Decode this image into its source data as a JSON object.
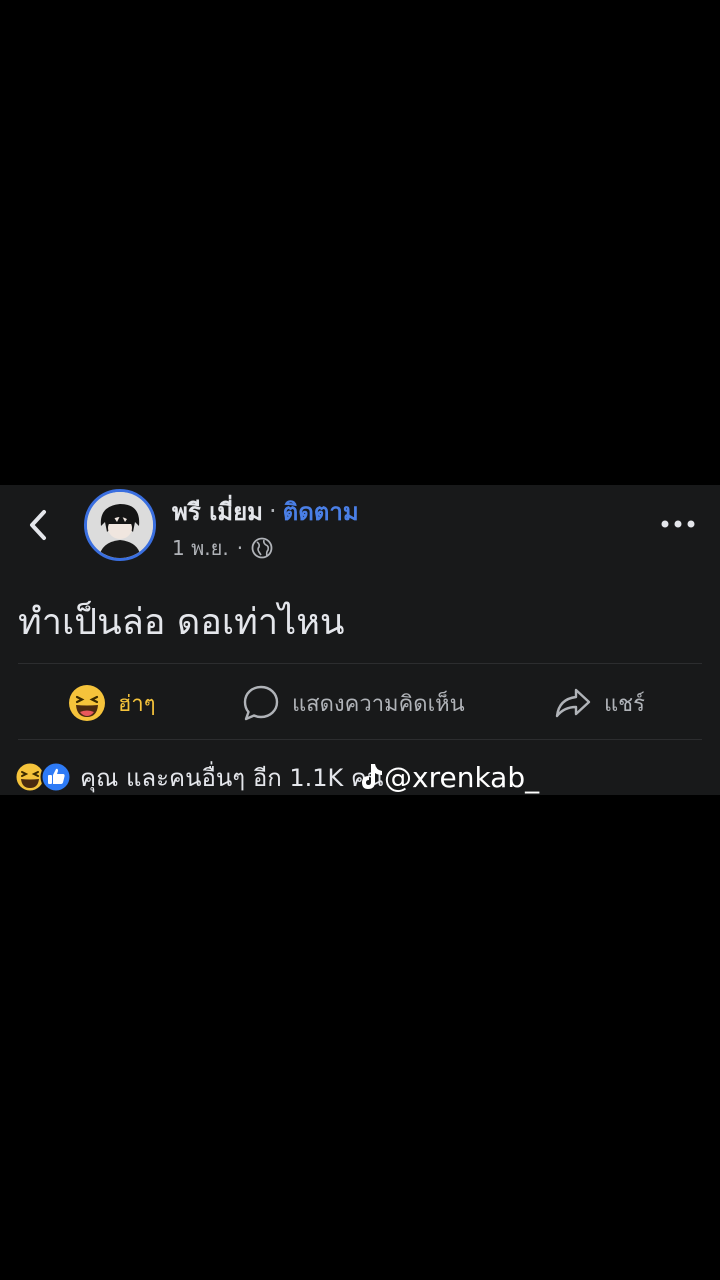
{
  "post": {
    "author_name": "พรี เมี่ยม",
    "separator": "·",
    "follow_label": "ติดตาม",
    "timestamp": "1 พ.ย.",
    "privacy_icon": "globe-icon",
    "text": "ทำเป็นล่อ ดอเท่าไหน"
  },
  "actions": {
    "haha_label": "ฮ่าๆ",
    "comment_label": "แสดงความคิดเห็น",
    "share_label": "แชร์"
  },
  "reactions": {
    "summary": "คุณ และคนอื่นๆ อีก 1.1K คน",
    "icons": [
      "haha-icon",
      "like-icon"
    ]
  },
  "watermark": {
    "handle": "@xrenkab_"
  },
  "colors": {
    "background": "#000000",
    "card": "#18191a",
    "follow_blue": "#4a7fe6",
    "haha_yellow": "#f5c33b",
    "like_blue": "#2e7bf6"
  }
}
